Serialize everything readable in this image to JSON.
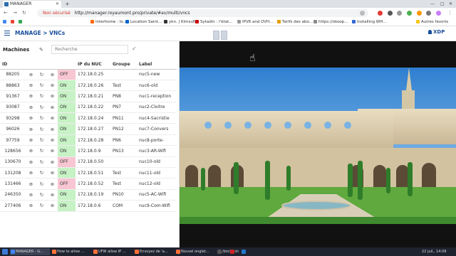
{
  "browser": {
    "tab_title": "MANAGER",
    "address_insecure": "Non sécurisé",
    "address_url": "http://manager.royaumont.pro/private/#av/multi/vncs"
  },
  "bookmarks": [
    {
      "label": "",
      "color": "#4285f4"
    },
    {
      "label": "",
      "color": "#ea4335"
    },
    {
      "label": "",
      "color": "#34a853"
    },
    {
      "label": "Interhome : lo...",
      "color": "#ff6600"
    },
    {
      "label": "Location Saint...",
      "color": "#0066cc"
    },
    {
      "label": "ykn. | Kimsufi...",
      "color": "#333333"
    },
    {
      "label": "Sytadin : l'état...",
      "color": "#cc0000"
    },
    {
      "label": "IPV6 and OVH...",
      "color": "#999999"
    },
    {
      "label": "Tarifs des abo...",
      "color": "#e89c00"
    },
    {
      "label": "https://okoop...",
      "color": "#888888"
    },
    {
      "label": "Installing WH...",
      "color": "#3367d6"
    },
    {
      "label": "Autres favoris",
      "color": "#f5c518"
    }
  ],
  "app": {
    "title": "MANAGE > VNCs",
    "xdp_label": "XDP",
    "machines_label": "Machines",
    "search_placeholder": "Recherche",
    "columns": [
      "ID",
      "",
      "",
      "",
      "",
      "IP du NUC",
      "Groupe",
      "Label"
    ],
    "rows": [
      {
        "id": "88205",
        "status": "OFF",
        "ip": "172.18.0.25",
        "group": "",
        "label": "nuc5-new"
      },
      {
        "id": "88863",
        "status": "ON",
        "ip": "172.18.0.26",
        "group": "Test",
        "label": "nuc6-old"
      },
      {
        "id": "91367",
        "status": "ON",
        "ip": "172.18.0.21",
        "group": "PN8",
        "label": "nuc1-reception"
      },
      {
        "id": "93087",
        "status": "ON",
        "ip": "172.18.0.22",
        "group": "PN7",
        "label": "nuc2-Cloitre"
      },
      {
        "id": "93298",
        "status": "ON",
        "ip": "172.18.0.24",
        "group": "PN11",
        "label": "nuc4-Sacristie"
      },
      {
        "id": "96026",
        "status": "ON",
        "ip": "172.18.0.27",
        "group": "PN12",
        "label": "nuc7-Convers"
      },
      {
        "id": "97759",
        "status": "ON",
        "ip": "172.18.0.28",
        "group": "PN6",
        "label": "nuc8-porte-"
      },
      {
        "id": "128656",
        "status": "ON",
        "ip": "172.18.0.9",
        "group": "PN13",
        "label": "nuc3-AR-Wifi"
      },
      {
        "id": "130670",
        "status": "OFF",
        "ip": "172.18.0.50",
        "group": "",
        "label": "nuc10-old"
      },
      {
        "id": "131208",
        "status": "ON",
        "ip": "172.18.0.51",
        "group": "Test",
        "label": "nuc11-old"
      },
      {
        "id": "131466",
        "status": "OFF",
        "ip": "172.18.0.52",
        "group": "Test",
        "label": "nuc12-old"
      },
      {
        "id": "246350",
        "status": "ON",
        "ip": "172.18.0.19",
        "group": "PN10",
        "label": "nuc5-AC-Wifi"
      },
      {
        "id": "277406",
        "status": "ON",
        "ip": "172.18.0.6",
        "group": "COM",
        "label": "nuc9-Com-Wifi"
      }
    ]
  },
  "taskbar": {
    "items": [
      {
        "label": "MANAGER - G...",
        "color": "#4285f4",
        "active": true
      },
      {
        "label": "How to allow ...",
        "color": "#ff7139",
        "active": false
      },
      {
        "label": "UFW allow IP ...",
        "color": "#ff7139",
        "active": false
      },
      {
        "label": "Envoyez de 'a...",
        "color": "#ff7139",
        "active": false
      },
      {
        "label": "Nouvel onglet...",
        "color": "#ff7139",
        "active": false
      },
      {
        "label": "/bin/bash",
        "color": "#555555",
        "active": false
      },
      {
        "label": "",
        "color": "#cc2222",
        "active": false
      },
      {
        "label": "",
        "color": "#2277cc",
        "active": false
      }
    ],
    "clock": "22 juil., 14:09"
  }
}
